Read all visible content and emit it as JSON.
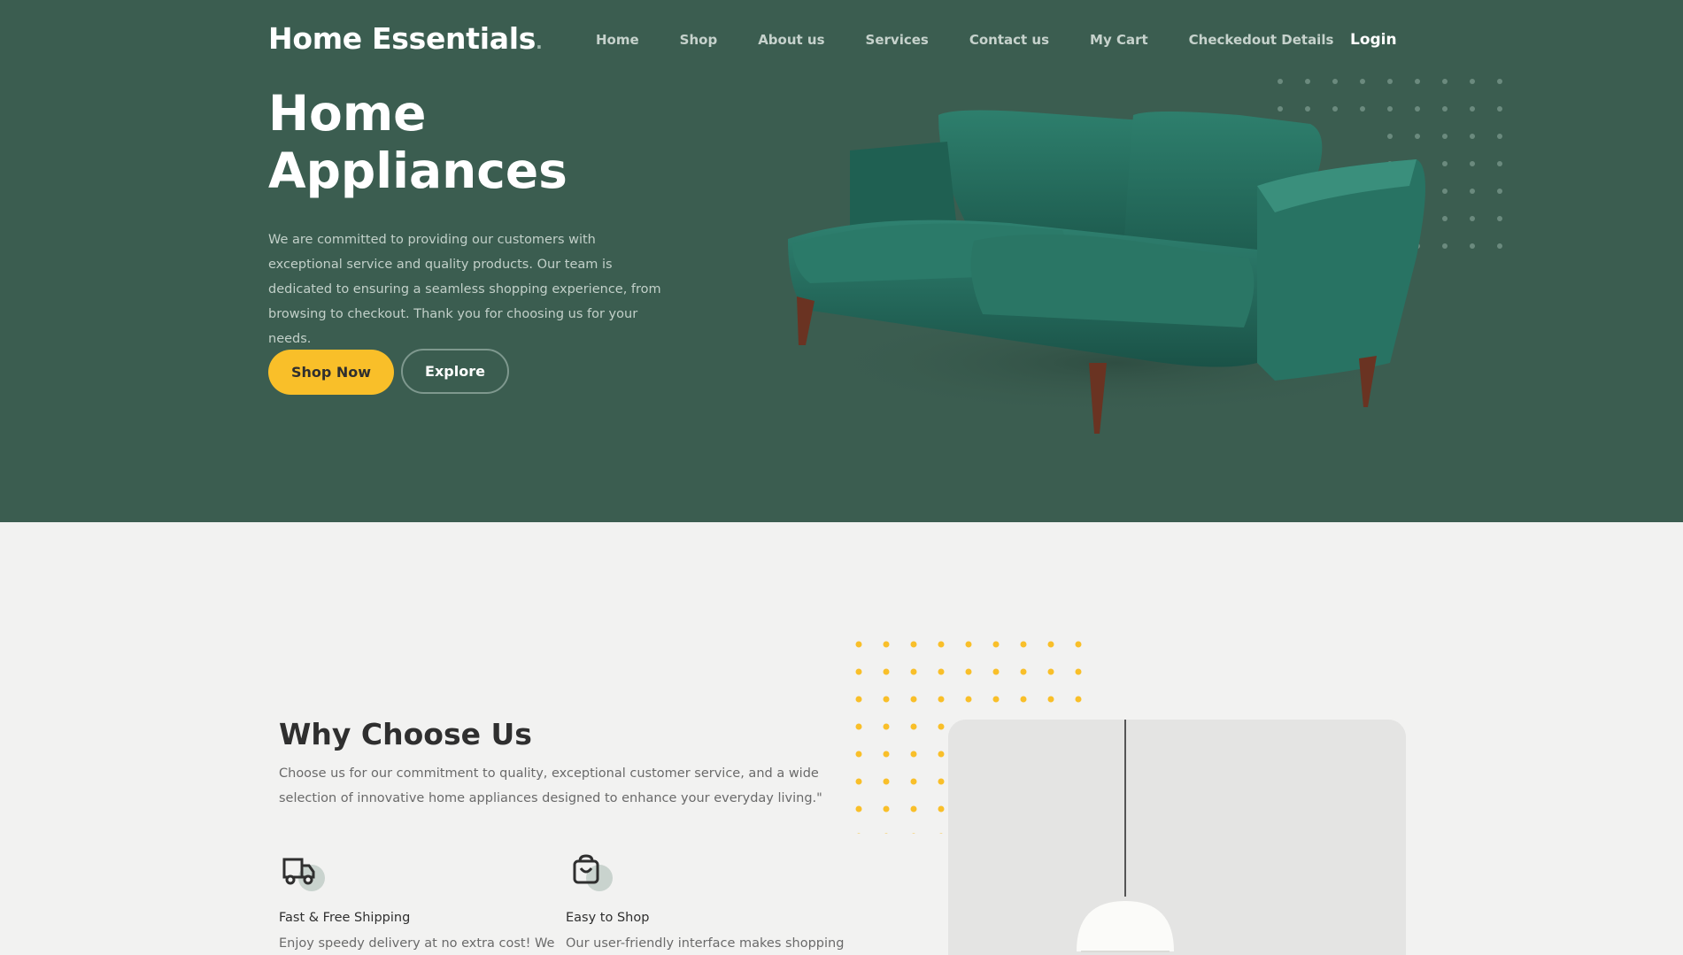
{
  "brand": {
    "name": "Home Essentials",
    "dot": "."
  },
  "nav": {
    "items": [
      "Home",
      "Shop",
      "About us",
      "Services",
      "Contact us",
      "My Cart",
      "Checkedout Details"
    ],
    "login": "Login"
  },
  "hero": {
    "title_line1": "Home",
    "title_line2": "Appliances",
    "description": "We are committed to providing our customers with exceptional service and quality products. Our team is dedicated to ensuring a seamless shopping experience, from browsing to checkout. Thank you for choosing us for your needs.",
    "shop_now": "Shop Now",
    "explore": "Explore"
  },
  "why": {
    "title": "Why Choose Us",
    "description": "Choose us for our commitment to quality, exceptional customer service, and a wide selection of innovative home appliances designed to enhance your everyday living.\"",
    "features": [
      {
        "title": "Fast & Free Shipping",
        "desc": "Enjoy speedy delivery at no extra cost! We",
        "icon": "truck-icon"
      },
      {
        "title": "Easy to Shop",
        "desc": "Our user-friendly interface makes shopping",
        "icon": "shopping-bag-icon"
      }
    ]
  },
  "colors": {
    "hero_bg": "#3b5d50",
    "accent_yellow": "#f9bf29",
    "page_bg": "#f2f2f1"
  }
}
